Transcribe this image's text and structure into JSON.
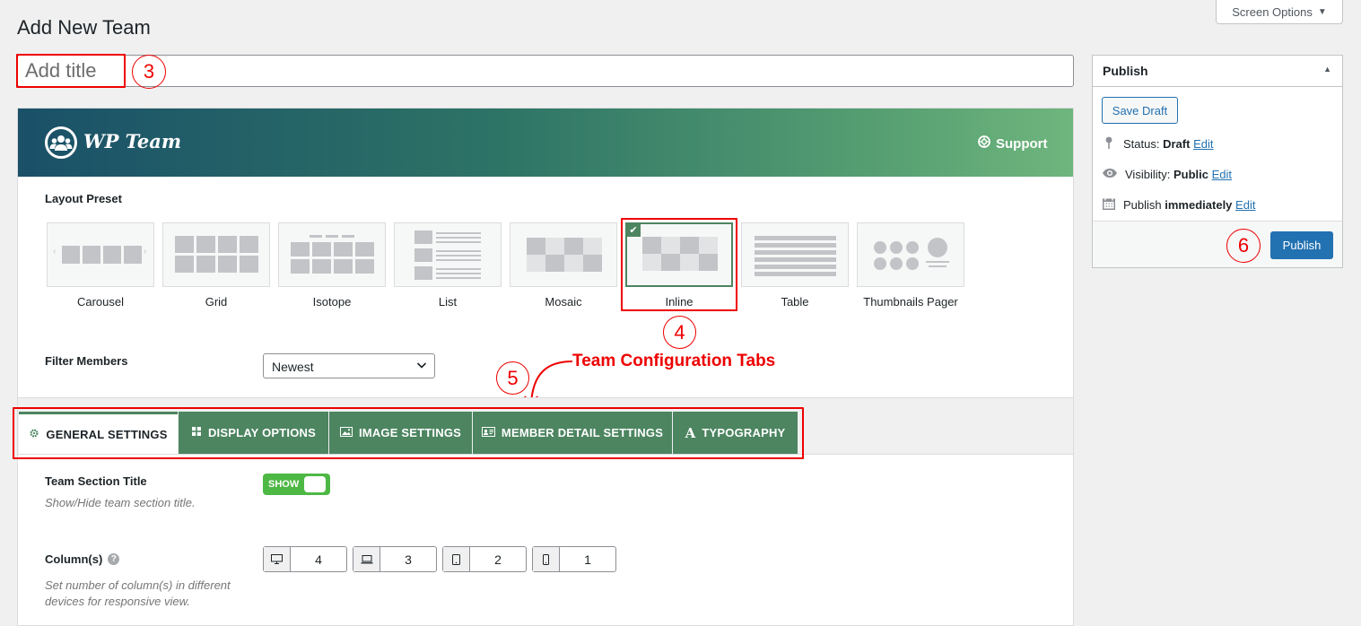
{
  "page_title": "Add New Team",
  "screen_options": "Screen Options",
  "title_input": {
    "placeholder": "Add title"
  },
  "annotations": {
    "n3": "3",
    "n4": "4",
    "n5": "5",
    "n6": "6",
    "tabs_note": "Team Configuration Tabs"
  },
  "banner": {
    "logo": "WP Team",
    "support": "Support"
  },
  "layout_preset": {
    "label": "Layout Preset",
    "selected": "Inline",
    "items": [
      "Carousel",
      "Grid",
      "Isotope",
      "List",
      "Mosaic",
      "Inline",
      "Table",
      "Thumbnails Pager"
    ]
  },
  "filter": {
    "label": "Filter Members",
    "value": "Newest"
  },
  "tabs": [
    {
      "label": "GENERAL SETTINGS",
      "icon": "gear-icon",
      "active": true
    },
    {
      "label": "DISPLAY OPTIONS",
      "icon": "grid-icon",
      "active": false
    },
    {
      "label": "IMAGE SETTINGS",
      "icon": "image-icon",
      "active": false
    },
    {
      "label": "MEMBER DETAIL SETTINGS",
      "icon": "id-card-icon",
      "active": false
    },
    {
      "label": "TYPOGRAPHY",
      "icon": "letter-a-icon",
      "active": false
    }
  ],
  "section_title": {
    "label": "Team Section Title",
    "desc": "Show/Hide team section title.",
    "toggle": "SHOW"
  },
  "columns": {
    "label": "Column(s)",
    "desc_line1": "Set number of column(s) in different",
    "desc_line2": "devices for responsive view.",
    "values": [
      "4",
      "3",
      "2",
      "1"
    ]
  },
  "publish": {
    "title": "Publish",
    "save_draft": "Save Draft",
    "status_label": "Status:",
    "status_value": "Draft",
    "visibility_label": "Visibility:",
    "visibility_value": "Public",
    "publish_label": "Publish",
    "publish_value": "immediately",
    "edit": "Edit",
    "publish_button": "Publish"
  },
  "colors": {
    "accent_green": "#4c8560",
    "wp_blue": "#2271b1",
    "annotation_red": "#ee0000"
  }
}
